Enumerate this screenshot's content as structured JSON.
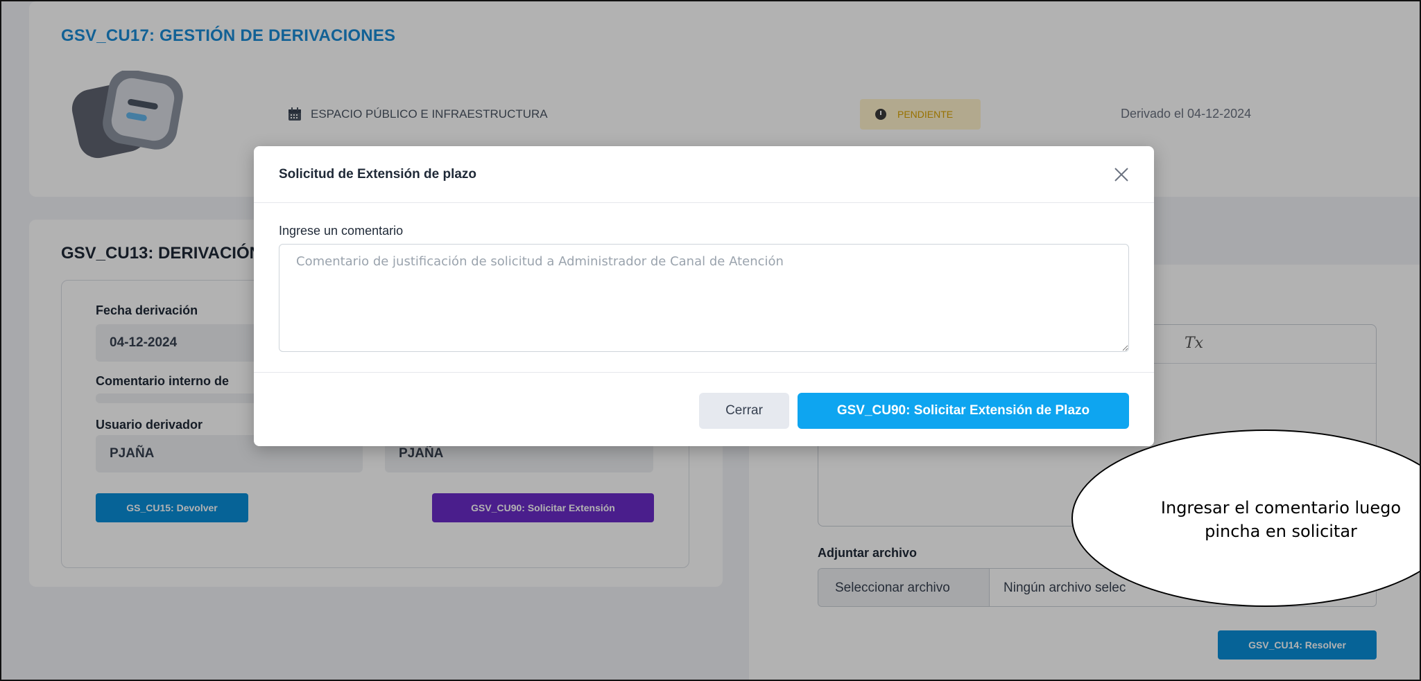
{
  "page": {
    "title": "GSV_CU17: GESTIÓN DE DERIVACIONES",
    "category": "ESPACIO PÚBLICO E INFRAESTRUCTURA",
    "status": "PENDIENTE",
    "derived_text": "Derivado el 04-12-2024",
    "colors": {
      "accent": "#1a8bd6",
      "status_bg": "#fff2cc",
      "status_text": "#d9a300",
      "purple": "#6a2cc9",
      "primary": "#0ea5f0"
    }
  },
  "derivation": {
    "title": "GSV_CU13: DERIVACIÓN",
    "fecha_label": "Fecha derivación",
    "fecha_value": "04-12-2024",
    "comentario_label": "Comentario interno de",
    "usuario_label": "Usuario derivador",
    "usuario_value": "PJAÑA",
    "usuario_value_2": "PJAÑA",
    "return_button": "GS_CU15: Devolver",
    "extension_button": "GSV_CU90: Solicitar Extensión"
  },
  "resolution": {
    "attach_label": "Adjuntar archivo",
    "file_button": "Seleccionar archivo",
    "file_name": "Ningún archivo selec",
    "resolve_button": "GSV_CU14: Resolver",
    "clear_format_icon": "Tx"
  },
  "modal": {
    "title": "Solicitud de Extensión de plazo",
    "comment_label": "Ingrese un comentario",
    "comment_placeholder": "Comentario de justificación de solicitud a Administrador de Canal de Atención",
    "close_button": "Cerrar",
    "submit_button": "GSV_CU90: Solicitar Extensión de Plazo"
  },
  "annotation": {
    "text": "Ingresar el comentario luego pincha en solicitar"
  },
  "icons": [
    "calendar-icon",
    "clock-icon",
    "close-icon",
    "clear-format-icon"
  ]
}
